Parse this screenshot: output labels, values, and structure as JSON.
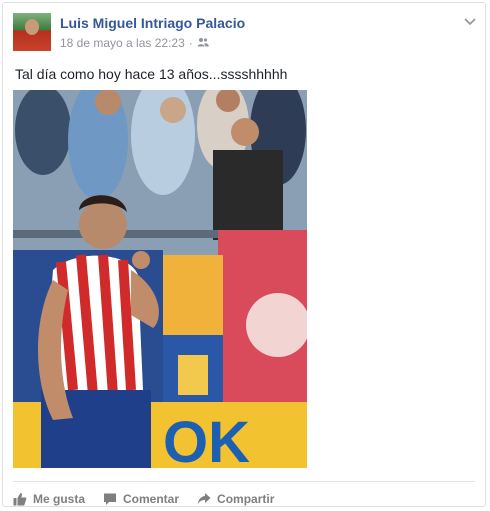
{
  "post": {
    "author": "Luis Miguel Intriago Palacio",
    "timestamp": "18 de mayo a las 22:23",
    "audience_icon": "friends-icon",
    "text": "Tal día como hoy hace 13 años...sssshhhhh"
  },
  "actions": {
    "like_label": "Me gusta",
    "comment_label": "Comentar",
    "share_label": "Compartir"
  },
  "photo": {
    "banner_text": "OK"
  },
  "colors": {
    "link": "#365899",
    "meta": "#90949c",
    "action": "#7f7f7f"
  }
}
